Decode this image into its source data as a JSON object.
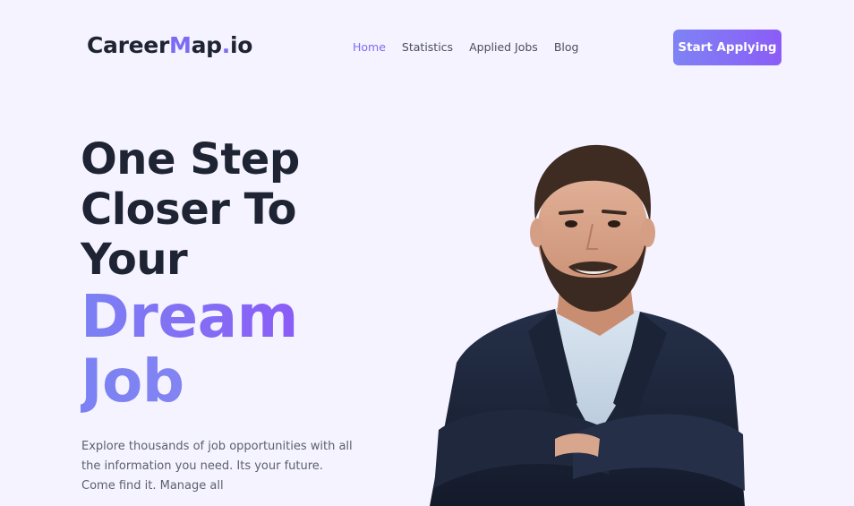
{
  "logo": {
    "part1": "Career",
    "part2": "M",
    "part3": "ap",
    "part4": ".",
    "part5": "io"
  },
  "nav": {
    "items": [
      {
        "label": "Home",
        "active": true
      },
      {
        "label": "Statistics",
        "active": false
      },
      {
        "label": "Applied Jobs",
        "active": false
      },
      {
        "label": "Blog",
        "active": false
      }
    ]
  },
  "cta": {
    "label": "Start Applying"
  },
  "hero": {
    "line1": "One Step",
    "line2": "Closer To",
    "line3": "Your",
    "line4": "Dream",
    "line5": "Job",
    "description": "Explore thousands of job opportunities with all the information you need. Its your future. Come find it. Manage all"
  },
  "colors": {
    "background": "#f5f3ff",
    "accent": "#7b6cf6",
    "text_dark": "#1e2433"
  },
  "image": {
    "icon": "person-photo"
  }
}
